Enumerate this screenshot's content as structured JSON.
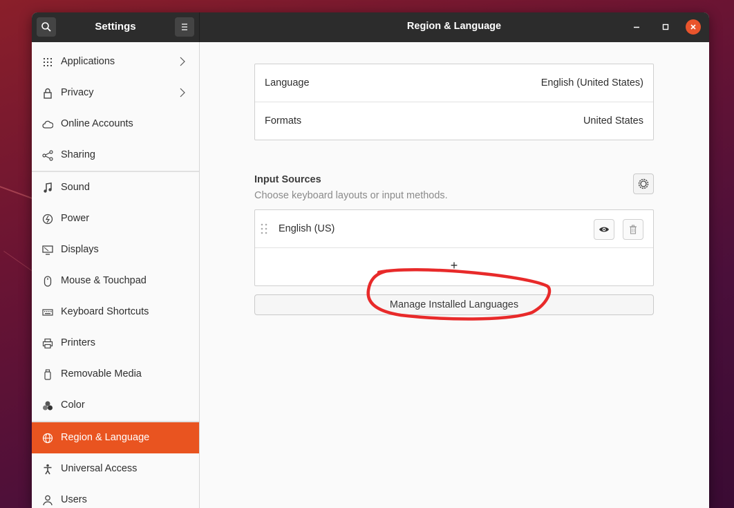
{
  "window": {
    "sidebar_title": "Settings",
    "title": "Region & Language"
  },
  "sidebar": {
    "items": [
      {
        "label": "Applications",
        "icon": "grid-icon"
      },
      {
        "label": "Privacy",
        "icon": "lock-icon"
      },
      {
        "label": "Online Accounts",
        "icon": "cloud-icon"
      },
      {
        "label": "Sharing",
        "icon": "share-icon"
      },
      {
        "label": "Sound",
        "icon": "music-note-icon"
      },
      {
        "label": "Power",
        "icon": "power-icon"
      },
      {
        "label": "Displays",
        "icon": "display-icon"
      },
      {
        "label": "Mouse & Touchpad",
        "icon": "mouse-icon"
      },
      {
        "label": "Keyboard Shortcuts",
        "icon": "keyboard-icon"
      },
      {
        "label": "Printers",
        "icon": "printer-icon"
      },
      {
        "label": "Removable Media",
        "icon": "usb-drive-icon"
      },
      {
        "label": "Color",
        "icon": "color-icon"
      },
      {
        "label": "Region & Language",
        "icon": "globe-icon",
        "active": true
      },
      {
        "label": "Universal Access",
        "icon": "accessibility-icon"
      },
      {
        "label": "Users",
        "icon": "user-icon"
      }
    ]
  },
  "language_panel": {
    "language_label": "Language",
    "language_value": "English (United States)",
    "formats_label": "Formats",
    "formats_value": "United States"
  },
  "input_sources": {
    "title": "Input Sources",
    "subtitle": "Choose keyboard layouts or input methods.",
    "sources": [
      {
        "label": "English (US)"
      }
    ],
    "add_symbol": "+"
  },
  "manage_button_label": "Manage Installed Languages",
  "colors": {
    "accent": "#e95420",
    "titlebar": "#2c2c2c",
    "annotation": "#e82a2a"
  }
}
